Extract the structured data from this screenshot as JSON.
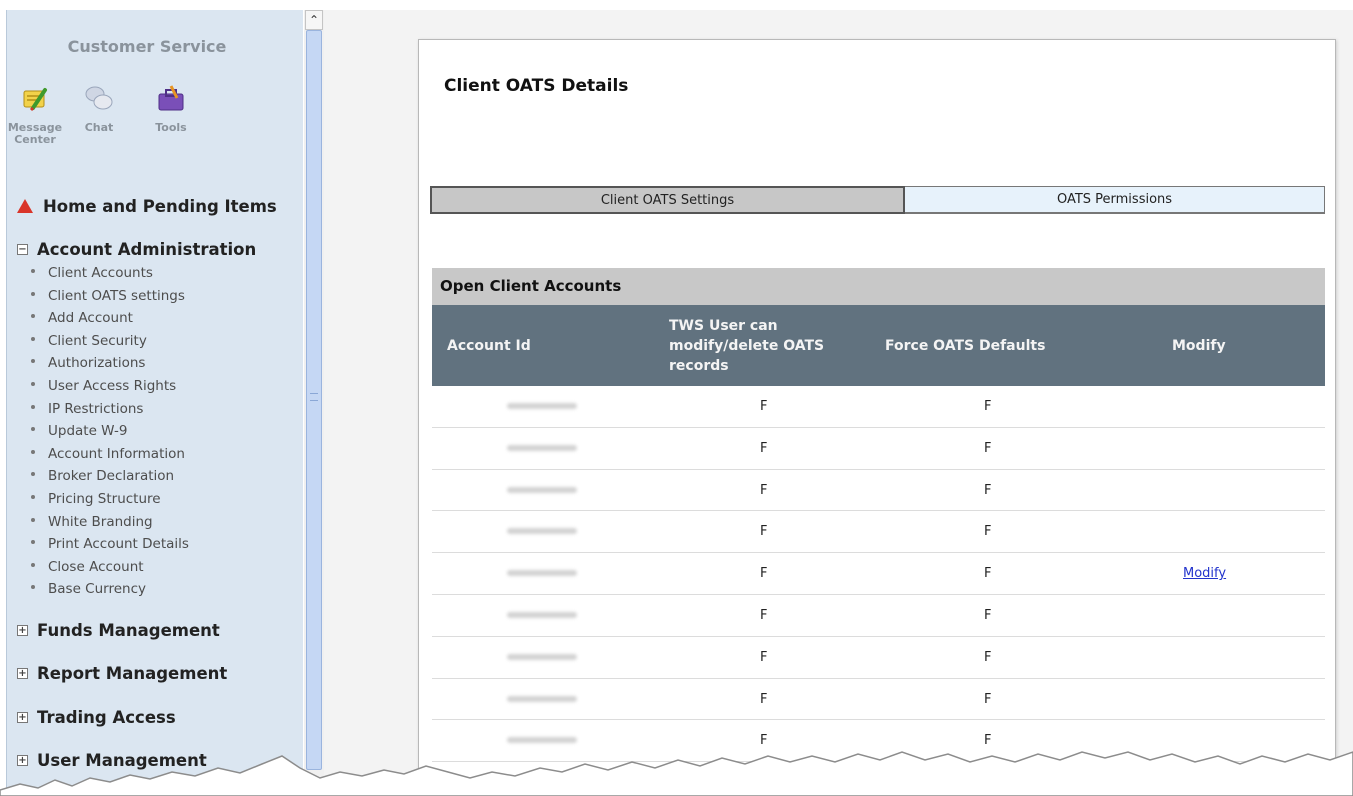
{
  "sidebar": {
    "title": "Customer Service",
    "tools": [
      {
        "label": "Message Center",
        "icon": "message-center-icon"
      },
      {
        "label": "Chat",
        "icon": "chat-icon"
      },
      {
        "label": "Tools",
        "icon": "tools-icon"
      }
    ],
    "sections": [
      {
        "label": "Home and Pending Items",
        "icon": "warning-icon"
      },
      {
        "label": "Account Administration",
        "state": "expanded"
      },
      {
        "label": "Funds Management",
        "state": "collapsed"
      },
      {
        "label": "Report Management",
        "state": "collapsed"
      },
      {
        "label": "Trading Access",
        "state": "collapsed"
      },
      {
        "label": "User Management",
        "state": "collapsed"
      }
    ],
    "account_admin_items": [
      "Client Accounts",
      "Client OATS settings",
      "Add Account",
      "Client Security",
      "Authorizations",
      "User Access Rights",
      "IP Restrictions",
      "Update W-9",
      "Account Information",
      "Broker Declaration",
      "Pricing Structure",
      "White Branding",
      "Print Account Details",
      "Close Account",
      "Base Currency"
    ],
    "expand_mark": "+",
    "collapse_mark": "−"
  },
  "main": {
    "title": "Client OATS Details",
    "tabs": [
      {
        "label": "Client OATS Settings",
        "active": true
      },
      {
        "label": "OATS Permissions",
        "active": false
      }
    ],
    "section_title": "Open Client Accounts",
    "columns": [
      "Account Id",
      "TWS User can modify/delete OATS records",
      "Force OATS Defaults",
      "Modify"
    ],
    "rows": [
      {
        "tws_modify": "F",
        "force_defaults": "F",
        "modify": ""
      },
      {
        "tws_modify": "F",
        "force_defaults": "F",
        "modify": ""
      },
      {
        "tws_modify": "F",
        "force_defaults": "F",
        "modify": ""
      },
      {
        "tws_modify": "F",
        "force_defaults": "F",
        "modify": ""
      },
      {
        "tws_modify": "F",
        "force_defaults": "F",
        "modify": "Modify"
      },
      {
        "tws_modify": "F",
        "force_defaults": "F",
        "modify": ""
      },
      {
        "tws_modify": "F",
        "force_defaults": "F",
        "modify": ""
      },
      {
        "tws_modify": "F",
        "force_defaults": "F",
        "modify": ""
      },
      {
        "tws_modify": "F",
        "force_defaults": "F",
        "modify": ""
      }
    ]
  },
  "colors": {
    "sidebar_bg": "#dbe6f1",
    "table_header_bg": "#61727f",
    "section_bg": "#c8c8c8",
    "link": "#2233cc",
    "warning": "#d9352a"
  }
}
